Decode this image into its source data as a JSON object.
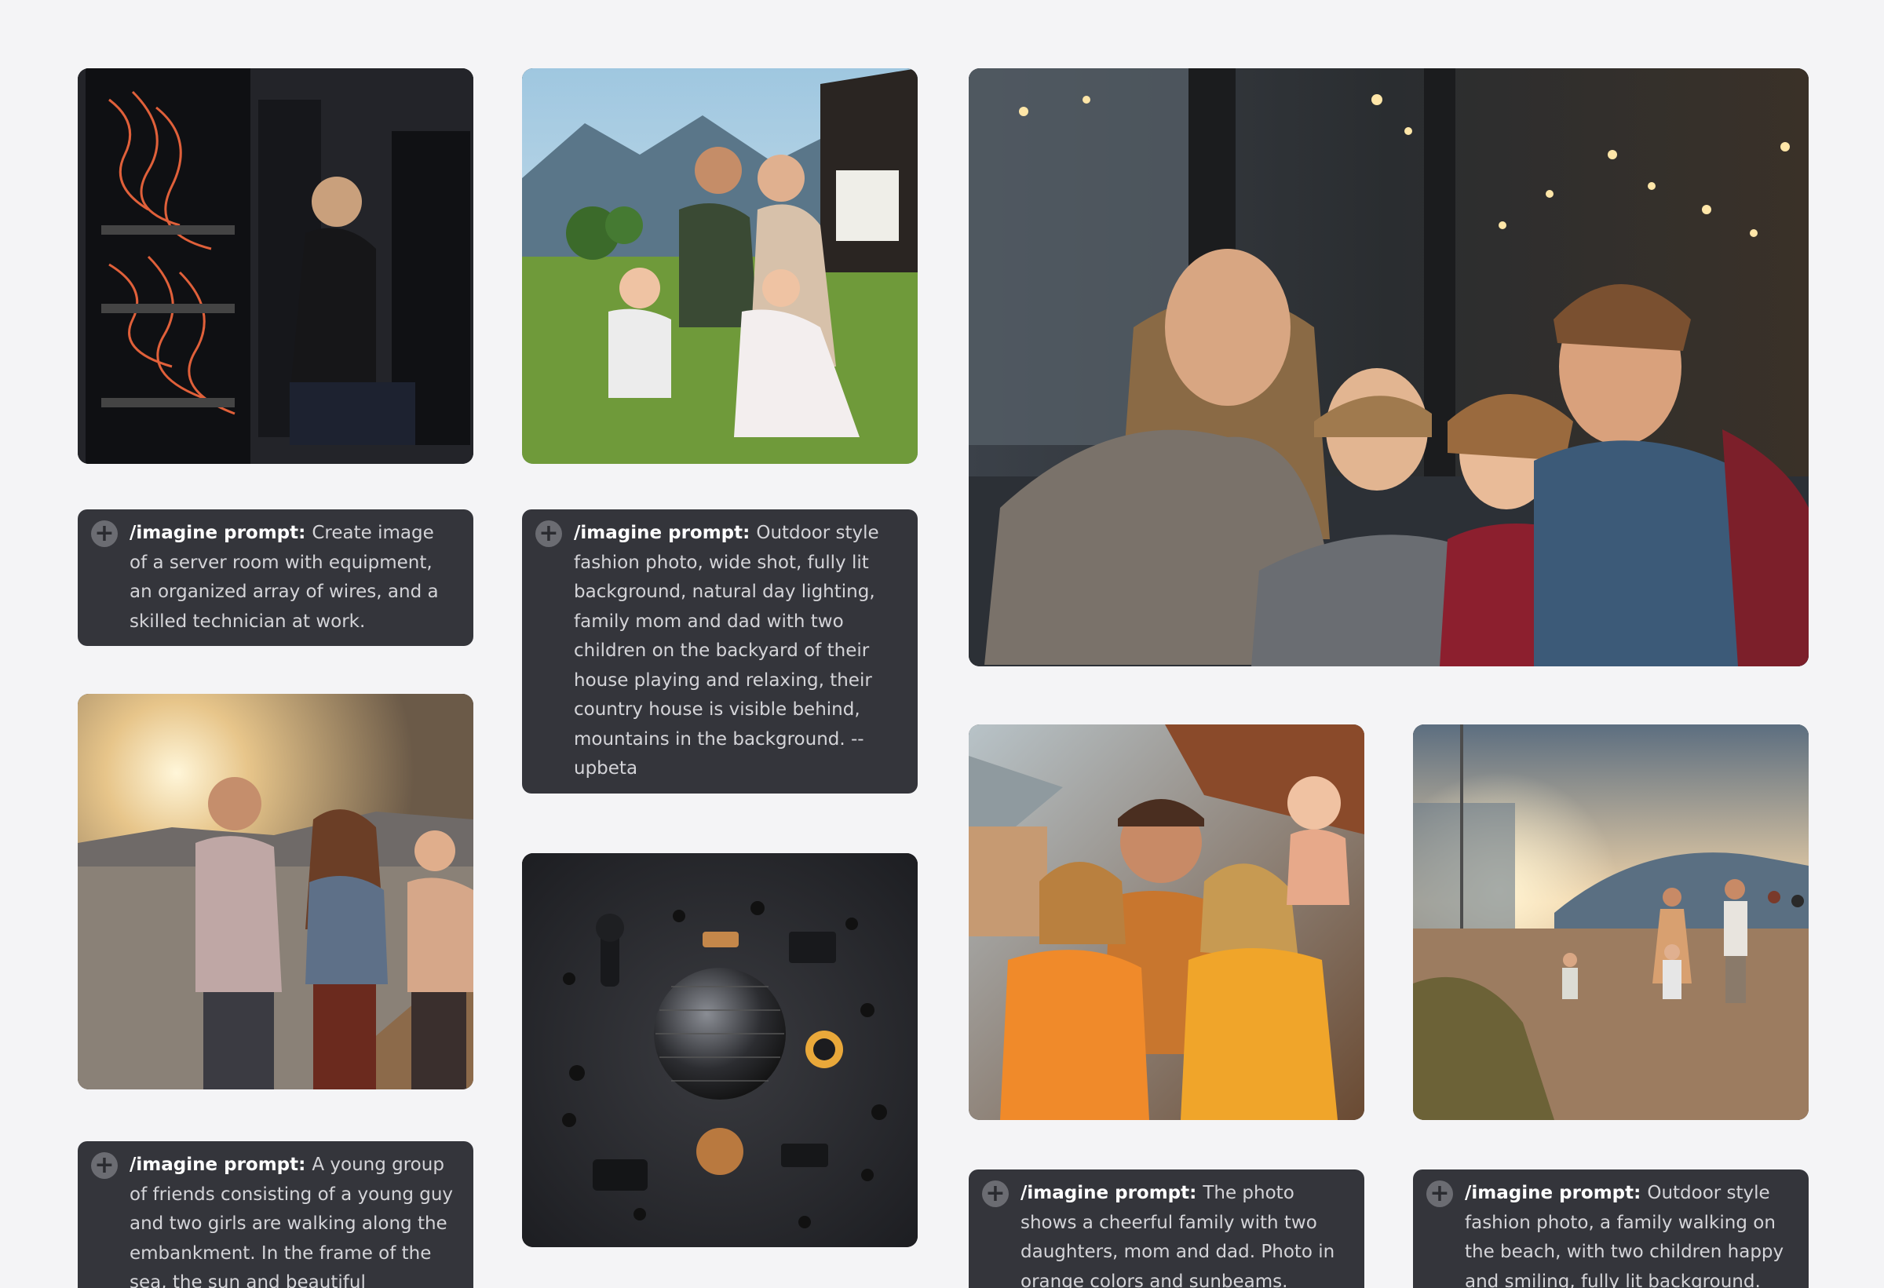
{
  "icons": {
    "add": "plus-circle-icon"
  },
  "cards": [
    {
      "id": "server-room",
      "image_alt": "server-room-photo",
      "prompt_label": "/imagine prompt:",
      "prompt_text": "Create image of a server room with equipment, an organized array of wires, and a skilled technician at work."
    },
    {
      "id": "family-backyard",
      "image_alt": "family-backyard-photo",
      "prompt_label": "/imagine prompt:",
      "prompt_text": "Outdoor style fashion photo, wide shot, fully lit background, natural day lighting, family mom and dad with two children on the backyard of their house playing and relaxing, their country house is visible behind, mountains in the background. --upbeta"
    },
    {
      "id": "family-sofa",
      "image_alt": "family-sofa-photo"
    },
    {
      "id": "friends-embankment",
      "image_alt": "friends-embankment-photo",
      "prompt_label": "/imagine prompt:",
      "prompt_text": "A young group of friends consisting of a young guy and two girls are walking along the embankment. In the frame of the sea, the sun and beautiful"
    },
    {
      "id": "knolling-gadgets",
      "image_alt": "gadgets-knolling-photo"
    },
    {
      "id": "family-orange",
      "image_alt": "family-orange-photo",
      "prompt_label": "/imagine prompt:",
      "prompt_text": "The photo shows a cheerful family with two daughters, mom and dad. Photo in orange colors and sunbeams."
    },
    {
      "id": "family-beach",
      "image_alt": "family-beach-photo",
      "prompt_label": "/imagine prompt:",
      "prompt_text": "Outdoor style fashion photo, a family walking on the beach, with two children happy and smiling, fully lit background."
    }
  ]
}
